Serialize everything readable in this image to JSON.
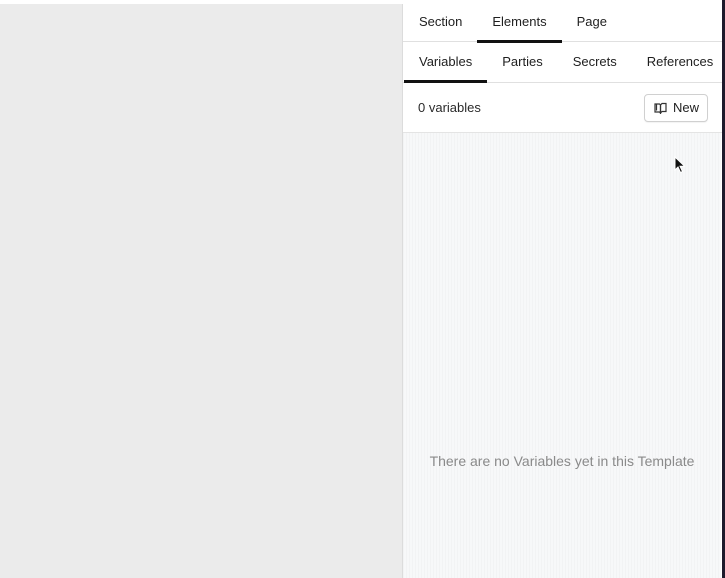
{
  "tabs": [
    {
      "label": "Section",
      "active": false
    },
    {
      "label": "Elements",
      "active": true
    },
    {
      "label": "Page",
      "active": false
    }
  ],
  "subtabs": [
    {
      "label": "Variables",
      "active": true
    },
    {
      "label": "Parties",
      "active": false
    },
    {
      "label": "Secrets",
      "active": false
    },
    {
      "label": "References",
      "active": false
    }
  ],
  "toolbar": {
    "count_label": "0 variables",
    "new_label": "New",
    "new_icon": "book-open-icon"
  },
  "empty_state": {
    "message": "There are no Variables yet in this Template"
  },
  "colors": {
    "canvas_bg": "#ebebeb",
    "panel_bg": "#ffffff",
    "empty_bg": "#f7f8f9",
    "active_indicator": "#111111"
  }
}
